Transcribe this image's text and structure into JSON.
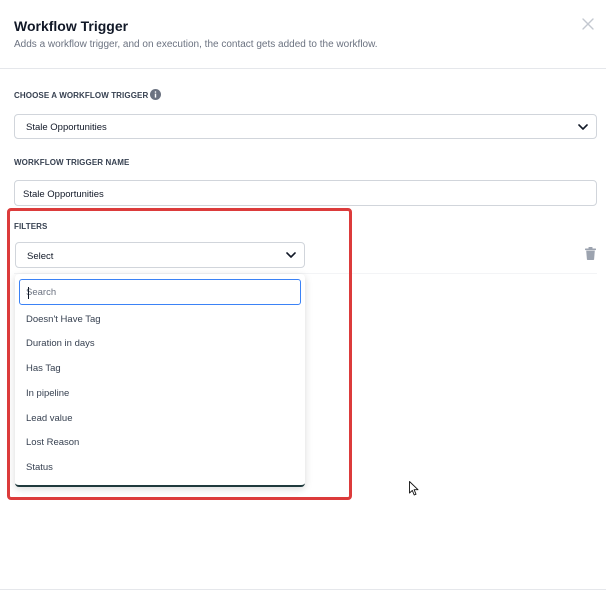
{
  "header": {
    "title": "Workflow Trigger",
    "subtitle": "Adds a workflow trigger, and on execution, the contact gets added to the workflow."
  },
  "trigger_choice": {
    "label": "CHOOSE A WORKFLOW TRIGGER",
    "value": "Stale Opportunities"
  },
  "trigger_name": {
    "label": "WORKFLOW TRIGGER NAME",
    "value": "Stale Opportunities"
  },
  "filters": {
    "label": "FILTERS",
    "select_value": "Select",
    "search_placeholder": "Search",
    "options": [
      "Doesn't Have Tag",
      "Duration in days",
      "Has Tag",
      "In pipeline",
      "Lead value",
      "Lost Reason",
      "Status"
    ]
  },
  "colors": {
    "highlight": "#dc3b3b",
    "focus": "#3b82f6"
  }
}
